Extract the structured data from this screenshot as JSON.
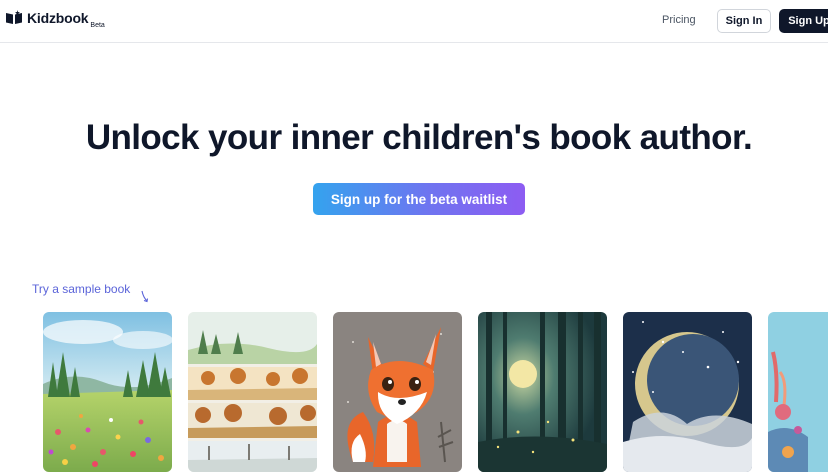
{
  "brand": {
    "name": "Kidzbook",
    "badge": "Beta"
  },
  "nav": {
    "pricing": "Pricing",
    "sign_in": "Sign In",
    "sign_up": "Sign Up"
  },
  "hero": {
    "title": "Unlock your inner children's book author.",
    "cta": "Sign up for the beta waitlist"
  },
  "samples": {
    "label": "Try a sample book",
    "books": [
      {
        "subject": "watercolor flower meadow"
      },
      {
        "subject": "four season landscape panels"
      },
      {
        "subject": "cartoon fox"
      },
      {
        "subject": "moonlit forest"
      },
      {
        "subject": "full moon night sky"
      },
      {
        "subject": "coral reef"
      }
    ]
  },
  "colors": {
    "text": "#0f172a",
    "accent_blue": "#34a3ee",
    "accent_purple": "#8d5cf2",
    "link": "#5b64d9"
  }
}
